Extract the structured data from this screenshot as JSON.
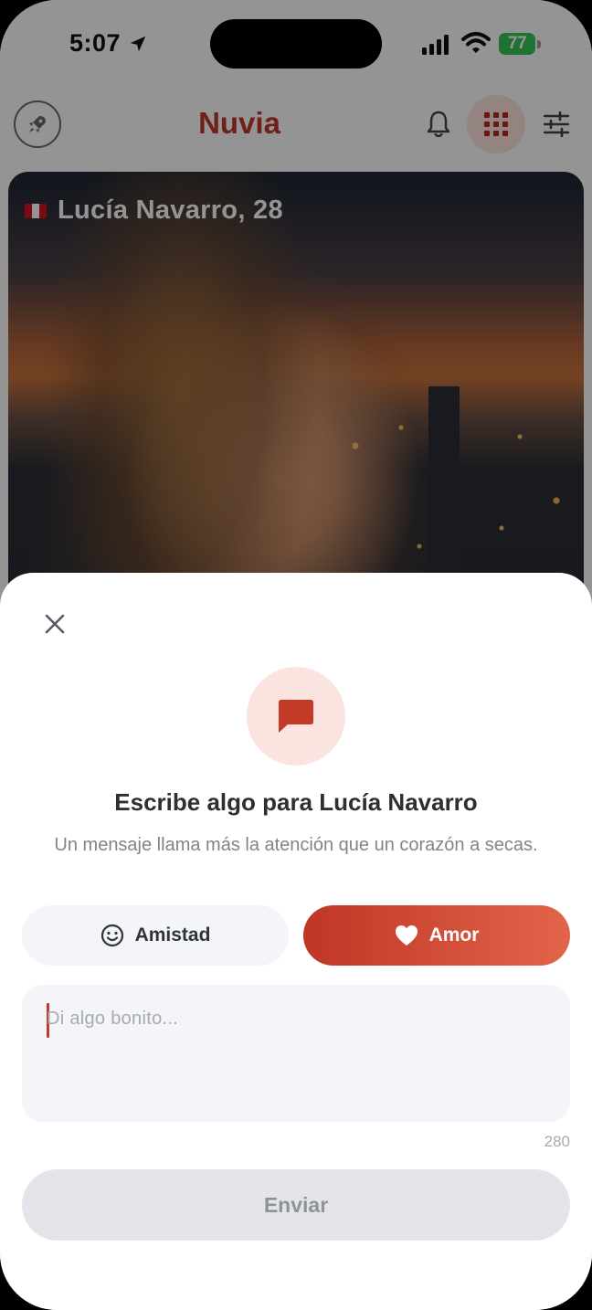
{
  "status_bar": {
    "time": "5:07",
    "battery": "77"
  },
  "app": {
    "logo": "Nuvia",
    "accent": "#c0392b",
    "icons": [
      "rocket-icon",
      "bell-icon",
      "grid-icon",
      "sliders-icon"
    ]
  },
  "profile": {
    "name_age": "Lucía Navarro, 28",
    "flag": "peru-flag-icon"
  },
  "sheet": {
    "icon": "chat-bubble-icon",
    "title": "Escribe algo para Lucía Navarro",
    "subtitle": "Un mensaje llama más la atención que un corazón a secas.",
    "tones": [
      {
        "label": "Amistad",
        "icon": "smiley-icon",
        "selected": false
      },
      {
        "label": "Amor",
        "icon": "heart-icon",
        "selected": true
      }
    ],
    "message": {
      "value": "",
      "placeholder": "Di algo bonito..."
    },
    "char_count": "280",
    "send_label": "Enviar"
  }
}
